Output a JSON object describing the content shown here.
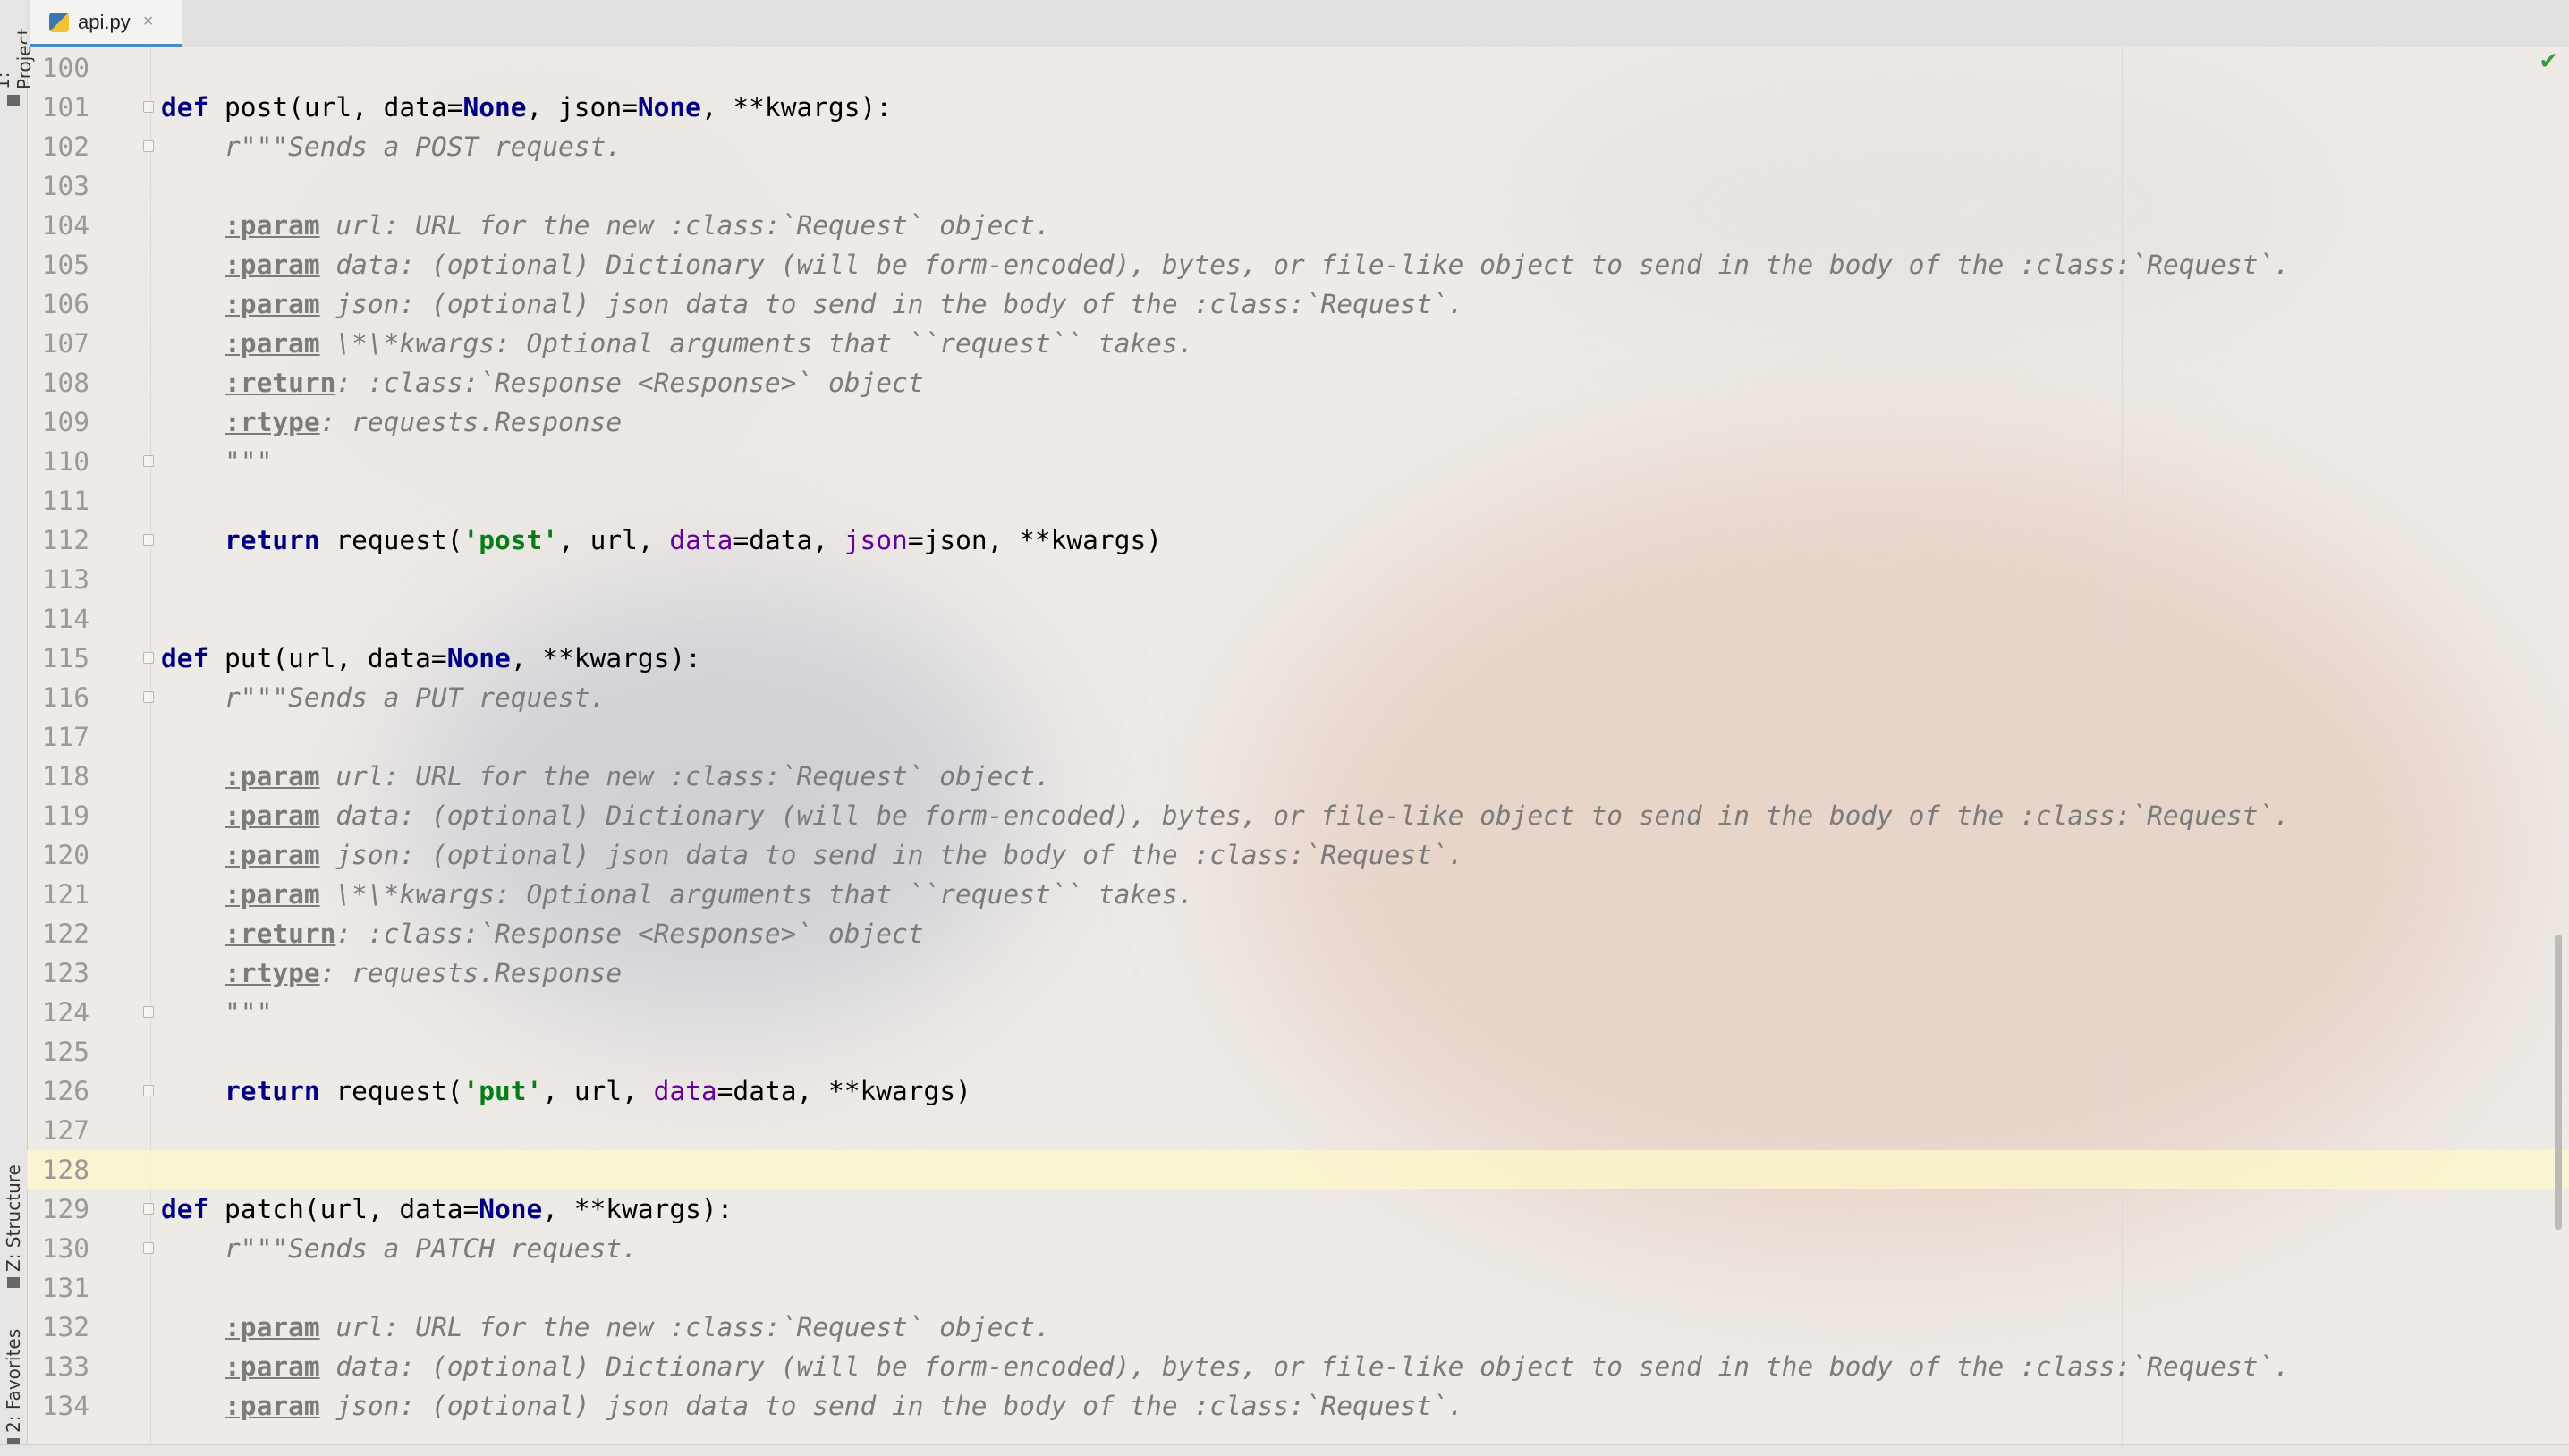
{
  "tab": {
    "filename": "api.py",
    "close_glyph": "×",
    "icon": "python-file-icon"
  },
  "tool_windows": {
    "project": "1: Project",
    "structure": "Z: Structure",
    "favorites": "2: Favorites"
  },
  "status": {
    "inspection_icon": "check-icon",
    "inspection_glyph": "✔"
  },
  "editor": {
    "current_line": 128,
    "lines": [
      {
        "n": "100",
        "t": []
      },
      {
        "n": "101",
        "fold": true,
        "t": [
          [
            "kw",
            "def "
          ],
          [
            "",
            "post(url, data="
          ],
          [
            "bi",
            "None"
          ],
          [
            "",
            ", json="
          ],
          [
            "bi",
            "None"
          ],
          [
            "",
            ", **kwargs):"
          ]
        ]
      },
      {
        "n": "102",
        "fold": true,
        "t": [
          [
            "doc",
            "    r\"\"\"Sends a POST request."
          ]
        ]
      },
      {
        "n": "103",
        "t": []
      },
      {
        "n": "104",
        "t": [
          [
            "",
            "    "
          ],
          [
            "tag",
            ":param"
          ],
          [
            "doc",
            " url: URL for the new :class:`Request` object."
          ]
        ]
      },
      {
        "n": "105",
        "t": [
          [
            "",
            "    "
          ],
          [
            "tag",
            ":param"
          ],
          [
            "doc",
            " data: (optional) Dictionary (will be form-encoded), bytes, or file-like object to send in the body of the :class:`Request`."
          ]
        ]
      },
      {
        "n": "106",
        "t": [
          [
            "",
            "    "
          ],
          [
            "tag",
            ":param"
          ],
          [
            "doc",
            " json: (optional) json data to send in the body of the :class:`Request`."
          ]
        ]
      },
      {
        "n": "107",
        "t": [
          [
            "",
            "    "
          ],
          [
            "tag",
            ":param"
          ],
          [
            "doc",
            " \\*\\*kwargs: Optional arguments that ``request`` takes."
          ]
        ]
      },
      {
        "n": "108",
        "t": [
          [
            "",
            "    "
          ],
          [
            "tag",
            ":return"
          ],
          [
            "doc",
            ": :class:`Response <Response>` object"
          ]
        ]
      },
      {
        "n": "109",
        "t": [
          [
            "",
            "    "
          ],
          [
            "tag",
            ":rtype"
          ],
          [
            "doc",
            ": requests.Response"
          ]
        ]
      },
      {
        "n": "110",
        "fold": true,
        "t": [
          [
            "doc",
            "    \"\"\""
          ]
        ]
      },
      {
        "n": "111",
        "t": []
      },
      {
        "n": "112",
        "fold": true,
        "t": [
          [
            "",
            "    "
          ],
          [
            "kw",
            "return"
          ],
          [
            "",
            " request("
          ],
          [
            "str",
            "'post'"
          ],
          [
            "",
            ", url, "
          ],
          [
            "kwarg",
            "data"
          ],
          [
            "",
            "=data, "
          ],
          [
            "kwarg",
            "json"
          ],
          [
            "",
            "=json, **kwargs)"
          ]
        ]
      },
      {
        "n": "113",
        "t": []
      },
      {
        "n": "114",
        "t": []
      },
      {
        "n": "115",
        "fold": true,
        "t": [
          [
            "kw",
            "def "
          ],
          [
            "",
            "put(url, data="
          ],
          [
            "bi",
            "None"
          ],
          [
            "",
            ", **kwargs):"
          ]
        ]
      },
      {
        "n": "116",
        "fold": true,
        "t": [
          [
            "doc",
            "    r\"\"\"Sends a PUT request."
          ]
        ]
      },
      {
        "n": "117",
        "t": []
      },
      {
        "n": "118",
        "t": [
          [
            "",
            "    "
          ],
          [
            "tag",
            ":param"
          ],
          [
            "doc",
            " url: URL for the new :class:`Request` object."
          ]
        ]
      },
      {
        "n": "119",
        "t": [
          [
            "",
            "    "
          ],
          [
            "tag",
            ":param"
          ],
          [
            "doc",
            " data: (optional) Dictionary (will be form-encoded), bytes, or file-like object to send in the body of the :class:`Request`."
          ]
        ]
      },
      {
        "n": "120",
        "t": [
          [
            "",
            "    "
          ],
          [
            "tag",
            ":param"
          ],
          [
            "doc",
            " json: (optional) json data to send in the body of the :class:`Request`."
          ]
        ]
      },
      {
        "n": "121",
        "t": [
          [
            "",
            "    "
          ],
          [
            "tag",
            ":param"
          ],
          [
            "doc",
            " \\*\\*kwargs: Optional arguments that ``request`` takes."
          ]
        ]
      },
      {
        "n": "122",
        "t": [
          [
            "",
            "    "
          ],
          [
            "tag",
            ":return"
          ],
          [
            "doc",
            ": :class:`Response <Response>` object"
          ]
        ]
      },
      {
        "n": "123",
        "t": [
          [
            "",
            "    "
          ],
          [
            "tag",
            ":rtype"
          ],
          [
            "doc",
            ": requests.Response"
          ]
        ]
      },
      {
        "n": "124",
        "fold": true,
        "t": [
          [
            "doc",
            "    \"\"\""
          ]
        ]
      },
      {
        "n": "125",
        "t": []
      },
      {
        "n": "126",
        "fold": true,
        "t": [
          [
            "",
            "    "
          ],
          [
            "kw",
            "return"
          ],
          [
            "",
            " request("
          ],
          [
            "str",
            "'put'"
          ],
          [
            "",
            ", url, "
          ],
          [
            "kwarg",
            "data"
          ],
          [
            "",
            "=data, **kwargs)"
          ]
        ]
      },
      {
        "n": "127",
        "t": []
      },
      {
        "n": "128",
        "t": []
      },
      {
        "n": "129",
        "fold": true,
        "t": [
          [
            "kw",
            "def "
          ],
          [
            "",
            "patch(url, data="
          ],
          [
            "bi",
            "None"
          ],
          [
            "",
            ", **kwargs):"
          ]
        ]
      },
      {
        "n": "130",
        "fold": true,
        "t": [
          [
            "doc",
            "    r\"\"\"Sends a PATCH request."
          ]
        ]
      },
      {
        "n": "131",
        "t": []
      },
      {
        "n": "132",
        "t": [
          [
            "",
            "    "
          ],
          [
            "tag",
            ":param"
          ],
          [
            "doc",
            " url: URL for the new :class:`Request` object."
          ]
        ]
      },
      {
        "n": "133",
        "t": [
          [
            "",
            "    "
          ],
          [
            "tag",
            ":param"
          ],
          [
            "doc",
            " data: (optional) Dictionary (will be form-encoded), bytes, or file-like object to send in the body of the :class:`Request`."
          ]
        ]
      },
      {
        "n": "134",
        "t": [
          [
            "",
            "    "
          ],
          [
            "tag",
            ":param"
          ],
          [
            "doc",
            " json: (optional) json data to send in the body of the :class:`Request`."
          ]
        ]
      }
    ]
  }
}
